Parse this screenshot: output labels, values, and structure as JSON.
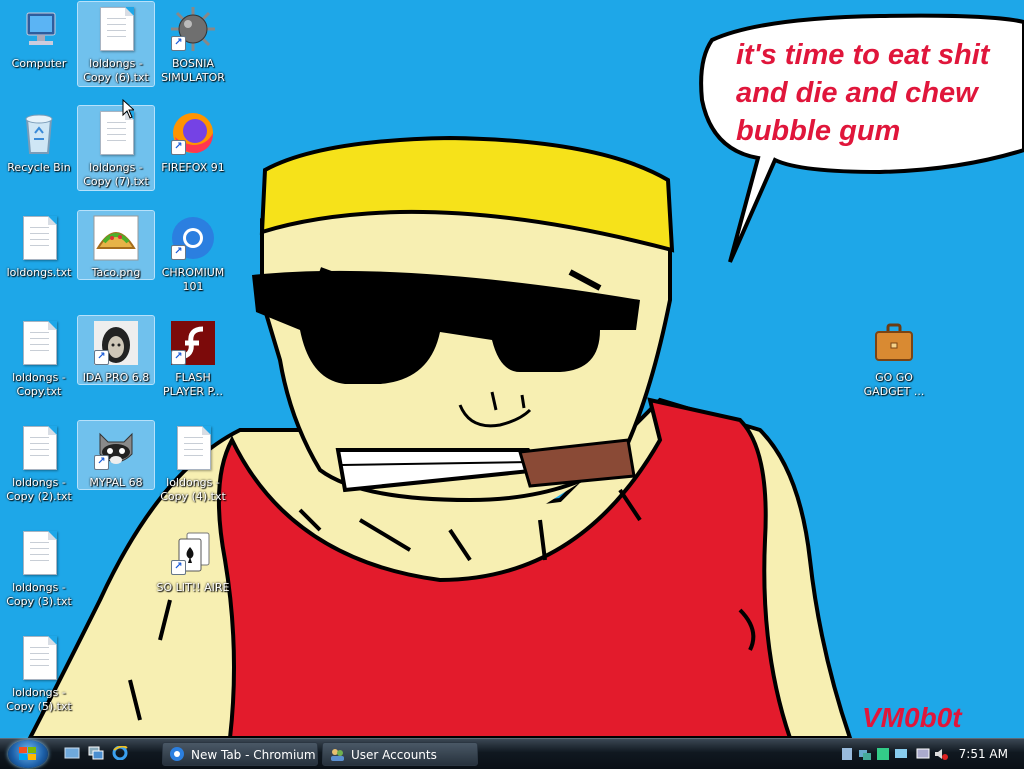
{
  "desktop": {
    "speech_bubble": "it's time to eat shit\nand die and chew\nbubble gum",
    "signature": "VM0b0t",
    "icons": [
      {
        "label": "Computer",
        "icon": "computer-icon"
      },
      {
        "label": "loldongs - Copy (6).txt",
        "icon": "text-file-icon"
      },
      {
        "label": "BOSNIA SIMULATOR",
        "icon": "spiked-mine-icon"
      },
      {
        "label": "Recycle Bin",
        "icon": "recycle-bin-icon"
      },
      {
        "label": "loldongs - Copy (7).txt",
        "icon": "text-file-icon"
      },
      {
        "label": "FIREFOX 91",
        "icon": "firefox-icon"
      },
      {
        "label": "loldongs.txt",
        "icon": "text-file-icon"
      },
      {
        "label": "Taco.png",
        "icon": "taco-image-icon"
      },
      {
        "label": "CHROMIUM 101",
        "icon": "chromium-icon"
      },
      {
        "label": "loldongs - Copy.txt",
        "icon": "text-file-icon"
      },
      {
        "label": "IDA PRO 6.8",
        "icon": "ida-pro-icon"
      },
      {
        "label": "FLASH PLAYER P...",
        "icon": "flash-player-icon"
      },
      {
        "label": "loldongs - Copy (2).txt",
        "icon": "text-file-icon"
      },
      {
        "label": "MYPAL 68",
        "icon": "raccoon-icon"
      },
      {
        "label": "loldongs - Copy (4).txt",
        "icon": "text-file-icon"
      },
      {
        "label": "SO LIT!! AIRE",
        "icon": "solitaire-icon"
      },
      {
        "label": "loldongs - Copy (3).txt",
        "icon": "text-file-icon"
      },
      {
        "label": "loldongs - Copy (5).txt",
        "icon": "text-file-icon"
      },
      {
        "label": "GO GO GADGET ...",
        "icon": "briefcase-icon"
      }
    ]
  },
  "taskbar": {
    "windows": [
      {
        "label": "New Tab - Chromium",
        "icon": "chromium-icon"
      },
      {
        "label": "User Accounts",
        "icon": "users-icon"
      }
    ],
    "quick_launch": [
      "show-desktop-icon",
      "switch-windows-icon",
      "internet-explorer-icon"
    ],
    "clock": "7:51 AM"
  },
  "colors": {
    "desktop": "#1ea7e8",
    "speech_text": "#e0163b"
  }
}
